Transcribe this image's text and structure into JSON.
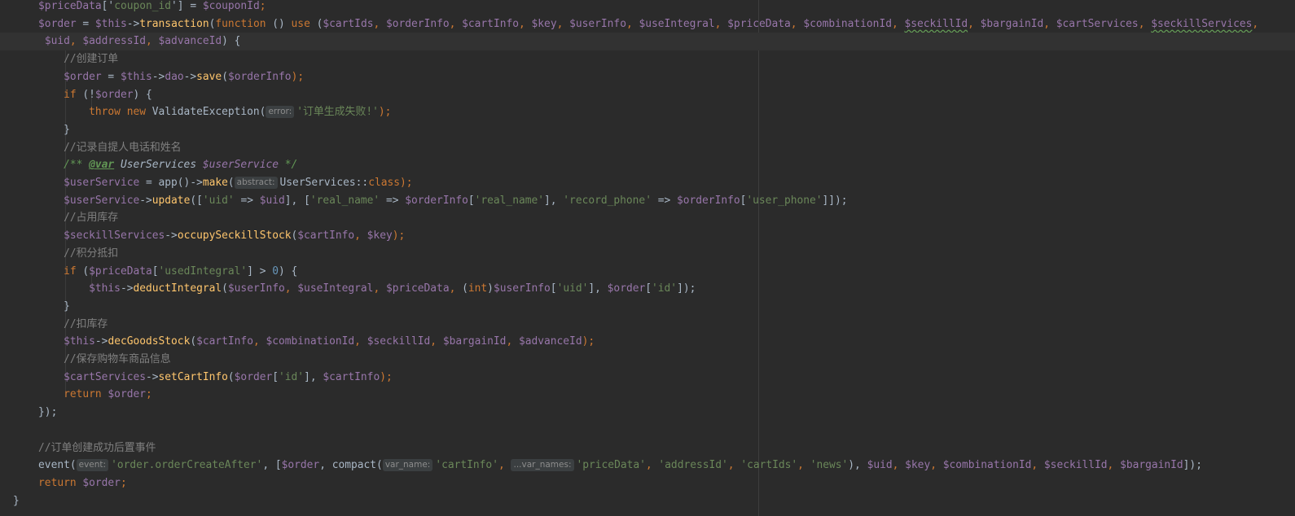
{
  "editor": {
    "lines": [
      {
        "tokens": [
          {
            "t": "    ",
            "c": "plain"
          },
          {
            "t": "$priceData",
            "c": "var"
          },
          {
            "t": "['",
            "c": "plain"
          },
          {
            "t": "coupon_id",
            "c": "str"
          },
          {
            "t": "'] = ",
            "c": "plain"
          },
          {
            "t": "$couponId",
            "c": "var"
          },
          {
            "t": ";",
            "c": "kw"
          }
        ]
      },
      {
        "tokens": [
          {
            "t": "    ",
            "c": "plain"
          },
          {
            "t": "$order",
            "c": "var"
          },
          {
            "t": " = ",
            "c": "plain"
          },
          {
            "t": "$this",
            "c": "var"
          },
          {
            "t": "->",
            "c": "plain"
          },
          {
            "t": "transaction",
            "c": "fn"
          },
          {
            "t": "(",
            "c": "plain"
          },
          {
            "t": "function",
            "c": "kw"
          },
          {
            "t": " () ",
            "c": "plain"
          },
          {
            "t": "use",
            "c": "kw"
          },
          {
            "t": " (",
            "c": "plain"
          },
          {
            "t": "$cartIds",
            "c": "var"
          },
          {
            "t": ", ",
            "c": "kw"
          },
          {
            "t": "$orderInfo",
            "c": "var"
          },
          {
            "t": ", ",
            "c": "kw"
          },
          {
            "t": "$cartInfo",
            "c": "var"
          },
          {
            "t": ", ",
            "c": "kw"
          },
          {
            "t": "$key",
            "c": "var"
          },
          {
            "t": ", ",
            "c": "kw"
          },
          {
            "t": "$userInfo",
            "c": "var"
          },
          {
            "t": ", ",
            "c": "kw"
          },
          {
            "t": "$useIntegral",
            "c": "var"
          },
          {
            "t": ", ",
            "c": "kw"
          },
          {
            "t": "$priceData",
            "c": "var"
          },
          {
            "t": ", ",
            "c": "kw"
          },
          {
            "t": "$combinationId",
            "c": "var"
          },
          {
            "t": ", ",
            "c": "kw"
          },
          {
            "t": "$seckillId",
            "c": "var squig"
          },
          {
            "t": ", ",
            "c": "kw"
          },
          {
            "t": "$bargainId",
            "c": "var"
          },
          {
            "t": ", ",
            "c": "kw"
          },
          {
            "t": "$cartServices",
            "c": "var"
          },
          {
            "t": ", ",
            "c": "kw"
          },
          {
            "t": "$seckillServices",
            "c": "var squig"
          },
          {
            "t": ",",
            "c": "kw"
          }
        ]
      },
      {
        "cur": true,
        "tokens": [
          {
            "t": "     ",
            "c": "plain"
          },
          {
            "t": "$uid",
            "c": "var"
          },
          {
            "t": ", ",
            "c": "kw"
          },
          {
            "t": "$addressId",
            "c": "var"
          },
          {
            "t": ", ",
            "c": "kw"
          },
          {
            "t": "$advanceId",
            "c": "var"
          },
          {
            "t": ") {",
            "c": "plain"
          }
        ]
      },
      {
        "tokens": [
          {
            "t": "        ",
            "c": "plain"
          },
          {
            "t": "//创建订单",
            "c": "cmt"
          }
        ]
      },
      {
        "tokens": [
          {
            "t": "        ",
            "c": "plain"
          },
          {
            "t": "$order",
            "c": "var"
          },
          {
            "t": " = ",
            "c": "plain"
          },
          {
            "t": "$this",
            "c": "var"
          },
          {
            "t": "->",
            "c": "plain"
          },
          {
            "t": "dao",
            "c": "var"
          },
          {
            "t": "->",
            "c": "plain"
          },
          {
            "t": "save",
            "c": "fn"
          },
          {
            "t": "(",
            "c": "plain"
          },
          {
            "t": "$orderInfo",
            "c": "var"
          },
          {
            "t": ");",
            "c": "kw"
          }
        ]
      },
      {
        "tokens": [
          {
            "t": "        ",
            "c": "plain"
          },
          {
            "t": "if",
            "c": "kw"
          },
          {
            "t": " (!",
            "c": "plain"
          },
          {
            "t": "$order",
            "c": "var"
          },
          {
            "t": ") {",
            "c": "plain"
          }
        ]
      },
      {
        "tokens": [
          {
            "t": "            ",
            "c": "plain"
          },
          {
            "t": "throw new ",
            "c": "kw"
          },
          {
            "t": "ValidateException(",
            "c": "plain"
          },
          {
            "hint": "error:"
          },
          {
            "t": "'订单生成失败!'",
            "c": "str"
          },
          {
            "t": ");",
            "c": "kw"
          }
        ]
      },
      {
        "tokens": [
          {
            "t": "        }",
            "c": "plain"
          }
        ]
      },
      {
        "tokens": [
          {
            "t": "        ",
            "c": "plain"
          },
          {
            "t": "//记录自提人电话和姓名",
            "c": "cmt"
          }
        ]
      },
      {
        "tokens": [
          {
            "t": "        ",
            "c": "plain"
          },
          {
            "t": "/** ",
            "c": "doc"
          },
          {
            "t": "@var",
            "c": "doctag"
          },
          {
            "t": " UserServices ",
            "c": "doctype"
          },
          {
            "t": "$userService",
            "c": "docvar"
          },
          {
            "t": " */",
            "c": "doc"
          }
        ]
      },
      {
        "tokens": [
          {
            "t": "        ",
            "c": "plain"
          },
          {
            "t": "$userService",
            "c": "var"
          },
          {
            "t": " = app()->",
            "c": "plain"
          },
          {
            "t": "make",
            "c": "fn"
          },
          {
            "t": "(",
            "c": "plain"
          },
          {
            "hint": "abstract:"
          },
          {
            "t": "UserServices::",
            "c": "plain"
          },
          {
            "t": "class",
            "c": "kw"
          },
          {
            "t": ");",
            "c": "kw"
          }
        ]
      },
      {
        "tokens": [
          {
            "t": "        ",
            "c": "plain"
          },
          {
            "t": "$userService",
            "c": "var"
          },
          {
            "t": "->",
            "c": "plain"
          },
          {
            "t": "update",
            "c": "fn"
          },
          {
            "t": "([",
            "c": "plain"
          },
          {
            "t": "'uid'",
            "c": "str"
          },
          {
            "t": " => ",
            "c": "plain"
          },
          {
            "t": "$uid",
            "c": "var"
          },
          {
            "t": "], [",
            "c": "plain"
          },
          {
            "t": "'real_name'",
            "c": "str"
          },
          {
            "t": " => ",
            "c": "plain"
          },
          {
            "t": "$orderInfo",
            "c": "var"
          },
          {
            "t": "[",
            "c": "plain"
          },
          {
            "t": "'real_name'",
            "c": "str"
          },
          {
            "t": "], ",
            "c": "plain"
          },
          {
            "t": "'record_phone'",
            "c": "str"
          },
          {
            "t": " => ",
            "c": "plain"
          },
          {
            "t": "$orderInfo",
            "c": "var"
          },
          {
            "t": "[",
            "c": "plain"
          },
          {
            "t": "'user_phone'",
            "c": "str"
          },
          {
            "t": "]]);",
            "c": "plain"
          }
        ]
      },
      {
        "tokens": [
          {
            "t": "        ",
            "c": "plain"
          },
          {
            "t": "//占用库存",
            "c": "cmt"
          }
        ]
      },
      {
        "tokens": [
          {
            "t": "        ",
            "c": "plain"
          },
          {
            "t": "$seckillServices",
            "c": "var"
          },
          {
            "t": "->",
            "c": "plain"
          },
          {
            "t": "occupySeckillStock",
            "c": "fn"
          },
          {
            "t": "(",
            "c": "plain"
          },
          {
            "t": "$cartInfo",
            "c": "var"
          },
          {
            "t": ", ",
            "c": "kw"
          },
          {
            "t": "$key",
            "c": "var"
          },
          {
            "t": ");",
            "c": "kw"
          }
        ]
      },
      {
        "tokens": [
          {
            "t": "        ",
            "c": "plain"
          },
          {
            "t": "//积分抵扣",
            "c": "cmt"
          }
        ]
      },
      {
        "tokens": [
          {
            "t": "        ",
            "c": "plain"
          },
          {
            "t": "if",
            "c": "kw"
          },
          {
            "t": " (",
            "c": "plain"
          },
          {
            "t": "$priceData",
            "c": "var"
          },
          {
            "t": "[",
            "c": "plain"
          },
          {
            "t": "'usedIntegral'",
            "c": "str"
          },
          {
            "t": "] > ",
            "c": "plain"
          },
          {
            "t": "0",
            "c": "num"
          },
          {
            "t": ") {",
            "c": "plain"
          }
        ]
      },
      {
        "tokens": [
          {
            "t": "            ",
            "c": "plain"
          },
          {
            "t": "$this",
            "c": "var"
          },
          {
            "t": "->",
            "c": "plain"
          },
          {
            "t": "deductIntegral",
            "c": "fn"
          },
          {
            "t": "(",
            "c": "plain"
          },
          {
            "t": "$userInfo",
            "c": "var"
          },
          {
            "t": ", ",
            "c": "kw"
          },
          {
            "t": "$useIntegral",
            "c": "var"
          },
          {
            "t": ", ",
            "c": "kw"
          },
          {
            "t": "$priceData",
            "c": "var"
          },
          {
            "t": ", ",
            "c": "kw"
          },
          {
            "t": "(",
            "c": "plain"
          },
          {
            "t": "int",
            "c": "kw"
          },
          {
            "t": ")",
            "c": "plain"
          },
          {
            "t": "$userInfo",
            "c": "var"
          },
          {
            "t": "[",
            "c": "plain"
          },
          {
            "t": "'uid'",
            "c": "str"
          },
          {
            "t": "], ",
            "c": "plain"
          },
          {
            "t": "$order",
            "c": "var"
          },
          {
            "t": "[",
            "c": "plain"
          },
          {
            "t": "'id'",
            "c": "str"
          },
          {
            "t": "]);",
            "c": "plain"
          }
        ]
      },
      {
        "tokens": [
          {
            "t": "        }",
            "c": "plain"
          }
        ]
      },
      {
        "tokens": [
          {
            "t": "        ",
            "c": "plain"
          },
          {
            "t": "//扣库存",
            "c": "cmt"
          }
        ]
      },
      {
        "tokens": [
          {
            "t": "        ",
            "c": "plain"
          },
          {
            "t": "$this",
            "c": "var"
          },
          {
            "t": "->",
            "c": "plain"
          },
          {
            "t": "decGoodsStock",
            "c": "fn"
          },
          {
            "t": "(",
            "c": "plain"
          },
          {
            "t": "$cartInfo",
            "c": "var"
          },
          {
            "t": ", ",
            "c": "kw"
          },
          {
            "t": "$combinationId",
            "c": "var"
          },
          {
            "t": ", ",
            "c": "kw"
          },
          {
            "t": "$seckillId",
            "c": "var"
          },
          {
            "t": ", ",
            "c": "kw"
          },
          {
            "t": "$bargainId",
            "c": "var"
          },
          {
            "t": ", ",
            "c": "kw"
          },
          {
            "t": "$advanceId",
            "c": "var"
          },
          {
            "t": ");",
            "c": "kw"
          }
        ]
      },
      {
        "tokens": [
          {
            "t": "        ",
            "c": "plain"
          },
          {
            "t": "//保存购物车商品信息",
            "c": "cmt"
          }
        ]
      },
      {
        "tokens": [
          {
            "t": "        ",
            "c": "plain"
          },
          {
            "t": "$cartServices",
            "c": "var"
          },
          {
            "t": "->",
            "c": "plain"
          },
          {
            "t": "setCartInfo",
            "c": "fn"
          },
          {
            "t": "(",
            "c": "plain"
          },
          {
            "t": "$order",
            "c": "var"
          },
          {
            "t": "[",
            "c": "plain"
          },
          {
            "t": "'id'",
            "c": "str"
          },
          {
            "t": "], ",
            "c": "plain"
          },
          {
            "t": "$cartInfo",
            "c": "var"
          },
          {
            "t": ");",
            "c": "kw"
          }
        ]
      },
      {
        "tokens": [
          {
            "t": "        ",
            "c": "plain"
          },
          {
            "t": "return ",
            "c": "kw"
          },
          {
            "t": "$order",
            "c": "var"
          },
          {
            "t": ";",
            "c": "kw"
          }
        ]
      },
      {
        "tokens": [
          {
            "t": "    });",
            "c": "plain"
          }
        ]
      },
      {
        "tokens": []
      },
      {
        "tokens": [
          {
            "t": "    ",
            "c": "plain"
          },
          {
            "t": "//订单创建成功后置事件",
            "c": "cmt"
          }
        ]
      },
      {
        "tokens": [
          {
            "t": "    event(",
            "c": "plain"
          },
          {
            "hint": "event:"
          },
          {
            "t": "'order.orderCreateAfter'",
            "c": "str"
          },
          {
            "t": ", [",
            "c": "plain"
          },
          {
            "t": "$order",
            "c": "var"
          },
          {
            "t": ", compact(",
            "c": "plain"
          },
          {
            "hint": "var_name:"
          },
          {
            "t": "'cartInfo'",
            "c": "str"
          },
          {
            "t": ", ",
            "c": "kw"
          },
          {
            "hint": "...var_names:"
          },
          {
            "t": "'priceData'",
            "c": "str"
          },
          {
            "t": ", ",
            "c": "kw"
          },
          {
            "t": "'addressId'",
            "c": "str"
          },
          {
            "t": ", ",
            "c": "kw"
          },
          {
            "t": "'cartIds'",
            "c": "str"
          },
          {
            "t": ", ",
            "c": "kw"
          },
          {
            "t": "'news'",
            "c": "str"
          },
          {
            "t": "), ",
            "c": "plain"
          },
          {
            "t": "$uid",
            "c": "var"
          },
          {
            "t": ", ",
            "c": "kw"
          },
          {
            "t": "$key",
            "c": "var"
          },
          {
            "t": ", ",
            "c": "kw"
          },
          {
            "t": "$combinationId",
            "c": "var"
          },
          {
            "t": ", ",
            "c": "kw"
          },
          {
            "t": "$seckillId",
            "c": "var"
          },
          {
            "t": ", ",
            "c": "kw"
          },
          {
            "t": "$bargainId",
            "c": "var"
          },
          {
            "t": "]);",
            "c": "plain"
          }
        ]
      },
      {
        "tokens": [
          {
            "t": "    ",
            "c": "plain"
          },
          {
            "t": "return ",
            "c": "kw"
          },
          {
            "t": "$order",
            "c": "var"
          },
          {
            "t": ";",
            "c": "kw"
          }
        ]
      },
      {
        "tokens": [
          {
            "t": "}",
            "c": "plain"
          }
        ]
      }
    ]
  }
}
